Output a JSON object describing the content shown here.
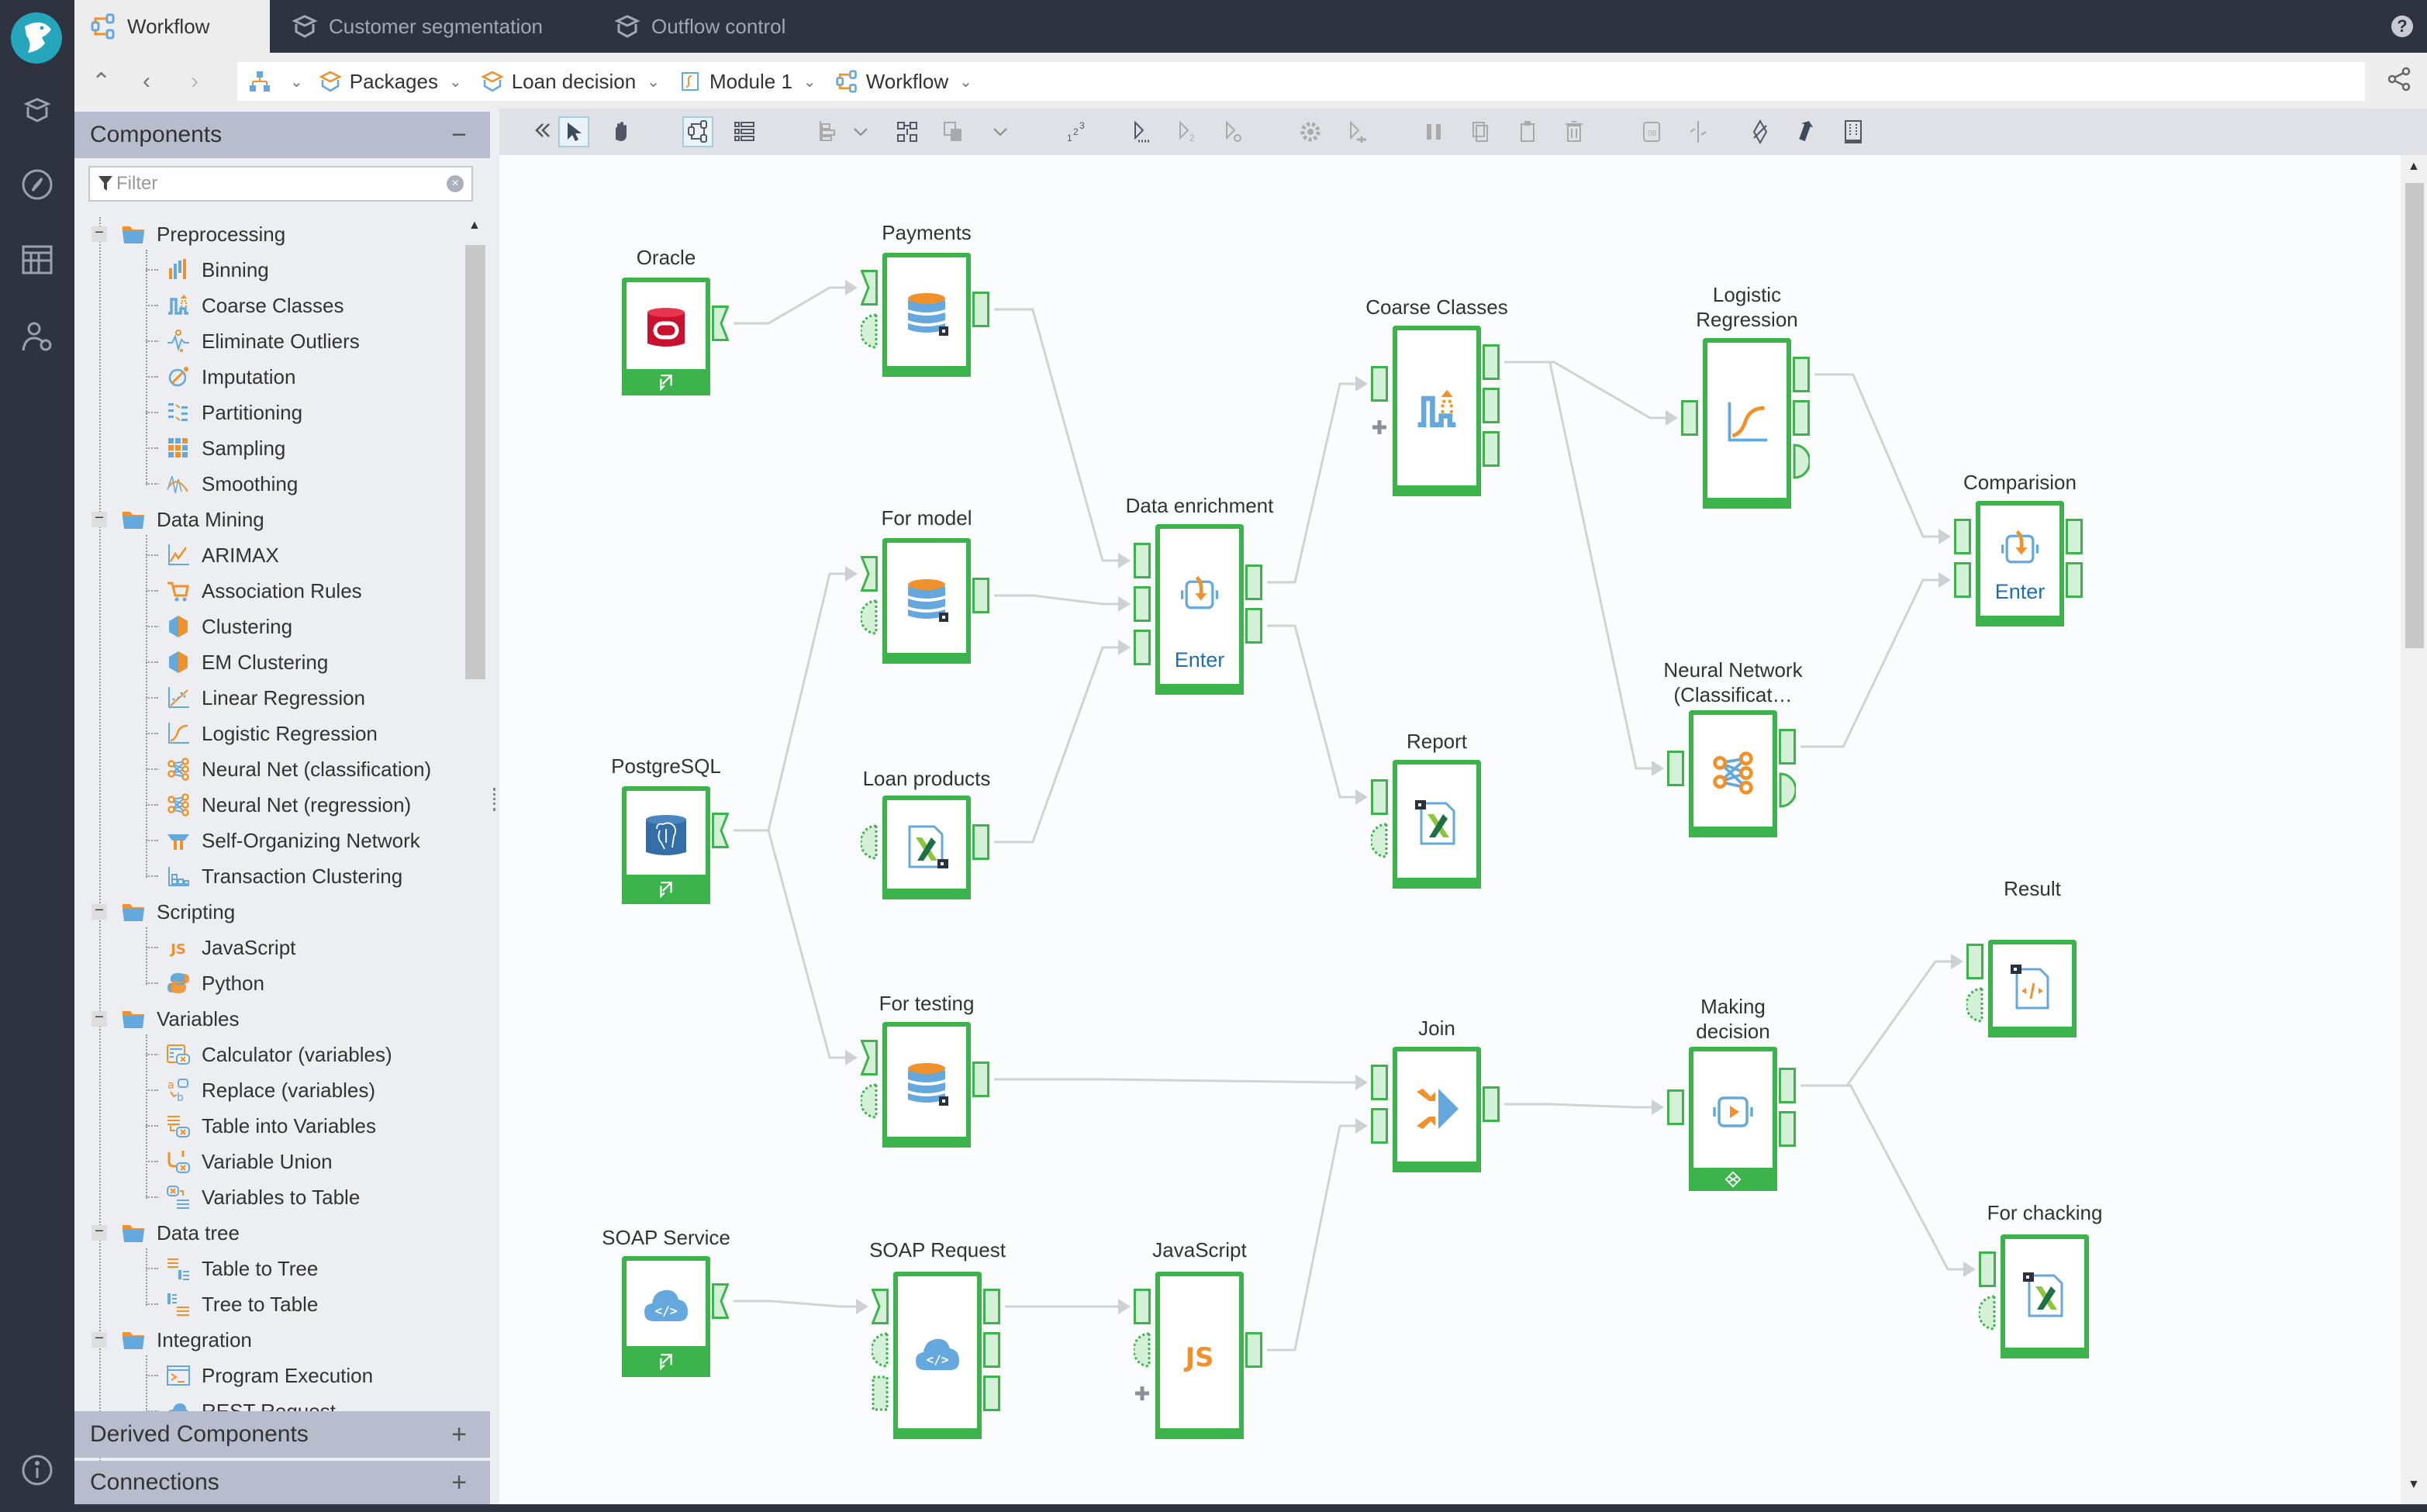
{
  "app": {
    "tabs": [
      {
        "label": "Workflow",
        "icon": "workflow-icon",
        "active": true
      },
      {
        "label": "Customer segmentation",
        "icon": "package-icon",
        "active": false
      },
      {
        "label": "Outflow control",
        "icon": "package-icon",
        "active": false
      }
    ],
    "help_label": "?"
  },
  "breadcrumbs": [
    {
      "label": "Packages",
      "icon": "package-icon"
    },
    {
      "label": "Loan decision",
      "icon": "package-icon"
    },
    {
      "label": "Module 1",
      "icon": "module-icon"
    },
    {
      "label": "Workflow",
      "icon": "workflow-icon"
    }
  ],
  "sidebar": {
    "components_title": "Components",
    "components_toggle": "−",
    "filter_placeholder": "Filter",
    "tree": [
      {
        "label": "Preprocessing",
        "type": "folder",
        "children": [
          {
            "label": "Binning",
            "icon": "binning-icon"
          },
          {
            "label": "Coarse Classes",
            "icon": "coarse-classes-icon"
          },
          {
            "label": "Eliminate Outliers",
            "icon": "outliers-icon"
          },
          {
            "label": "Imputation",
            "icon": "imputation-icon"
          },
          {
            "label": "Partitioning",
            "icon": "partitioning-icon"
          },
          {
            "label": "Sampling",
            "icon": "sampling-icon"
          },
          {
            "label": "Smoothing",
            "icon": "smoothing-icon"
          }
        ]
      },
      {
        "label": "Data Mining",
        "type": "folder",
        "children": [
          {
            "label": "ARIMAX",
            "icon": "arimax-icon"
          },
          {
            "label": "Association Rules",
            "icon": "cart-icon"
          },
          {
            "label": "Clustering",
            "icon": "cluster-icon"
          },
          {
            "label": "EM Clustering",
            "icon": "cluster-icon"
          },
          {
            "label": "Linear Regression",
            "icon": "linear-regression-icon"
          },
          {
            "label": "Logistic Regression",
            "icon": "logistic-regression-icon"
          },
          {
            "label": "Neural Net (classification)",
            "icon": "neural-net-icon"
          },
          {
            "label": "Neural Net (regression)",
            "icon": "neural-net-icon"
          },
          {
            "label": "Self-Organizing Network",
            "icon": "som-icon"
          },
          {
            "label": "Transaction Clustering",
            "icon": "transaction-icon"
          }
        ]
      },
      {
        "label": "Scripting",
        "type": "folder",
        "children": [
          {
            "label": "JavaScript",
            "icon": "javascript-icon"
          },
          {
            "label": "Python",
            "icon": "python-icon"
          }
        ]
      },
      {
        "label": "Variables",
        "type": "folder",
        "children": [
          {
            "label": "Calculator (variables)",
            "icon": "calculator-icon"
          },
          {
            "label": "Replace (variables)",
            "icon": "replace-icon"
          },
          {
            "label": "Table into Variables",
            "icon": "table-var-icon"
          },
          {
            "label": "Variable Union",
            "icon": "variable-union-icon"
          },
          {
            "label": "Variables to Table",
            "icon": "var-table-icon"
          }
        ]
      },
      {
        "label": "Data tree",
        "type": "folder",
        "children": [
          {
            "label": "Table to Tree",
            "icon": "table-tree-icon"
          },
          {
            "label": "Tree to Table",
            "icon": "tree-table-icon"
          }
        ]
      },
      {
        "label": "Integration",
        "type": "folder",
        "children": [
          {
            "label": "Program Execution",
            "icon": "terminal-icon"
          },
          {
            "label": "REST Request",
            "icon": "cloud-icon"
          }
        ]
      }
    ],
    "derived_title": "Derived Components",
    "derived_toggle": "+",
    "connections_title": "Connections",
    "connections_toggle": "+"
  },
  "toolbar": {
    "tools": [
      "collapse-panel",
      "select-tool",
      "pan-tool",
      "workflow-view",
      "list-view",
      "align",
      "align-dropdown",
      "layout",
      "copy-style",
      "copy-style-dropdown",
      "numbering",
      "run-to",
      "run-step",
      "run-settings",
      "settings",
      "run-node",
      "group",
      "copy",
      "paste",
      "delete",
      "package",
      "disconnect",
      "link",
      "jump",
      "frame"
    ]
  },
  "workflow": {
    "enter_label": "Enter",
    "nodes": [
      {
        "id": "oracle",
        "label": "Oracle",
        "icon": "oracle-icon",
        "footer": "import-icon"
      },
      {
        "id": "payments",
        "label": "Payments",
        "icon": "database-icon"
      },
      {
        "id": "formodel",
        "label": "For model",
        "icon": "database-icon"
      },
      {
        "id": "enrichment",
        "label": "Data enrichment",
        "icon": "supernode-icon",
        "enter": true
      },
      {
        "id": "coarse",
        "label": "Coarse Classes",
        "icon": "coarse-classes-icon"
      },
      {
        "id": "logreg",
        "label": "Logistic\nRegression",
        "icon": "logistic-regression-icon"
      },
      {
        "id": "comparision",
        "label": "Comparision",
        "icon": "supernode-icon",
        "enter": true
      },
      {
        "id": "postgres",
        "label": "PostgreSQL",
        "icon": "postgresql-icon",
        "footer": "import-icon"
      },
      {
        "id": "loanproducts",
        "label": "Loan products",
        "icon": "excel-icon"
      },
      {
        "id": "report",
        "label": "Report",
        "icon": "excel-export-icon"
      },
      {
        "id": "neural",
        "label": "Neural Network\n(Classificat…",
        "icon": "neural-net-icon"
      },
      {
        "id": "fortesting",
        "label": "For testing",
        "icon": "database-icon"
      },
      {
        "id": "join",
        "label": "Join",
        "icon": "join-icon"
      },
      {
        "id": "decision",
        "label": "Making\ndecision",
        "icon": "decision-icon",
        "footer": "loop-icon"
      },
      {
        "id": "result",
        "label": "Result",
        "icon": "code-file-icon"
      },
      {
        "id": "soapservice",
        "label": "SOAP Service",
        "icon": "soap-icon",
        "footer": "import-icon"
      },
      {
        "id": "soaprequest",
        "label": "SOAP Request",
        "icon": "soap-icon"
      },
      {
        "id": "javascript",
        "label": "JavaScript",
        "icon": "javascript-icon"
      },
      {
        "id": "forchacking",
        "label": "For chacking",
        "icon": "excel-export-icon"
      }
    ],
    "links": [
      [
        "oracle",
        "payments"
      ],
      [
        "payments",
        "enrichment"
      ],
      [
        "formodel",
        "enrichment"
      ],
      [
        "loanproducts",
        "enrichment"
      ],
      [
        "postgres",
        "formodel"
      ],
      [
        "postgres",
        "fortesting"
      ],
      [
        "enrichment",
        "coarse"
      ],
      [
        "enrichment",
        "report"
      ],
      [
        "coarse",
        "logreg"
      ],
      [
        "coarse",
        "neural"
      ],
      [
        "logreg",
        "comparision"
      ],
      [
        "neural",
        "comparision"
      ],
      [
        "fortesting",
        "join"
      ],
      [
        "javascript",
        "join"
      ],
      [
        "join",
        "decision"
      ],
      [
        "decision",
        "result"
      ],
      [
        "decision",
        "forchacking"
      ],
      [
        "soapservice",
        "soaprequest"
      ],
      [
        "soaprequest",
        "javascript"
      ]
    ]
  },
  "colors": {
    "node_border": "#3cb44b",
    "port_fill": "#d4f0d6",
    "link": "#d0d2d6",
    "accent_blue": "#64a8de",
    "accent_orange": "#f0912a"
  }
}
